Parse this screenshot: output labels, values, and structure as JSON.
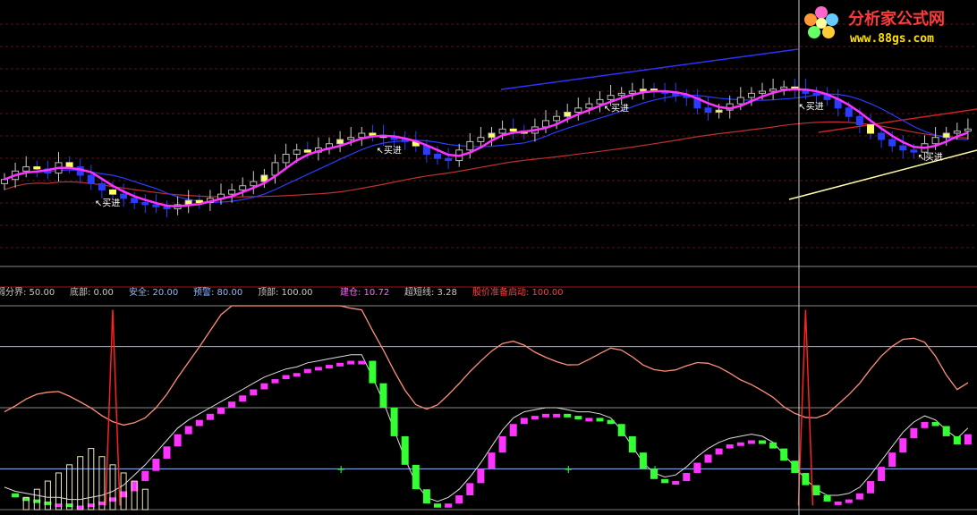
{
  "watermark": {
    "title": "分析家公式网",
    "url": "www.88gs.com"
  },
  "signals": [
    "买进",
    "买进",
    "买进",
    "买进",
    "买进"
  ],
  "legend": [
    {
      "label": "弱分界:",
      "value": "50.00",
      "color": "#c8c8c8"
    },
    {
      "label": "底部:",
      "value": "0.00",
      "color": "#c8c8c8"
    },
    {
      "label": "安全:",
      "value": "20.00",
      "color": "#8fb8ff"
    },
    {
      "label": "预警:",
      "value": "80.00",
      "color": "#8fb8ff"
    },
    {
      "label": "顶部:",
      "value": "100.00",
      "color": "#c8c8c8"
    },
    {
      "label": "建仓:",
      "value": "10.72",
      "color": "#ff66ff"
    },
    {
      "label": "超短线:",
      "value": "3.28",
      "color": "#c8c8c8"
    },
    {
      "label": "股价准备启动:",
      "value": "100.00",
      "color": "#ff4040"
    }
  ],
  "colors": {
    "magenta": "#ff33ff",
    "yellow": "#ffff66",
    "blue": "#2a3cff",
    "grey": "#8a8a8a",
    "salmon": "#ff8f7a",
    "green": "#33ff33",
    "red": "#ff2020",
    "darkred": "#c03030",
    "cream": "#ffffaa",
    "trend_blue": "#3030ff",
    "trend_red": "#cc2222",
    "white": "#ffffff"
  },
  "chart_data": [
    {
      "type": "candlestick",
      "overlays": [
        "short moving average (magenta)",
        "medium moving average (blue)",
        "long moving average (dark red)"
      ],
      "bars": 90,
      "closes": [
        38,
        42,
        44,
        43,
        41,
        46,
        44,
        40,
        36,
        33,
        31,
        29,
        27,
        26,
        25,
        24,
        26,
        28,
        27,
        29,
        31,
        33,
        35,
        37,
        40,
        46,
        50,
        52,
        51,
        53,
        55,
        57,
        58,
        60,
        59,
        58,
        57,
        56,
        54,
        50,
        48,
        47,
        52,
        56,
        58,
        60,
        62,
        61,
        60,
        63,
        66,
        68,
        70,
        72,
        74,
        76,
        78,
        79,
        80,
        81,
        80,
        79,
        78,
        77,
        72,
        70,
        71,
        74,
        77,
        79,
        80,
        81,
        82,
        81,
        79,
        78,
        76,
        72,
        68,
        64,
        60,
        57,
        54,
        52,
        51,
        55,
        58,
        60,
        61,
        62
      ]
    },
    {
      "type": "line",
      "indicator": true,
      "reference_levels": [
        0,
        20,
        50,
        80,
        100
      ],
      "legend_values": {
        "弱分界": 50.0,
        "底部": 0.0,
        "安全": 20.0,
        "预警": 80.0,
        "顶部": 100.0,
        "建仓": 10.72,
        "超短线": 3.28,
        "股价准备启动": 100.0
      },
      "oscillator": [
        8,
        6,
        5,
        4,
        3,
        3,
        2,
        2,
        3,
        4,
        6,
        9,
        14,
        19,
        25,
        31,
        37,
        41,
        44,
        47,
        50,
        53,
        56,
        59,
        62,
        64,
        66,
        67,
        69,
        70,
        71,
        72,
        73,
        73,
        62,
        50,
        36,
        22,
        10,
        3,
        1,
        3,
        7,
        13,
        20,
        28,
        36,
        42,
        45,
        46,
        47,
        47,
        46,
        45,
        45,
        44,
        42,
        36,
        28,
        20,
        15,
        13,
        14,
        18,
        23,
        27,
        30,
        32,
        33,
        34,
        33,
        30,
        24,
        18,
        12,
        7,
        4,
        4,
        5,
        8,
        14,
        21,
        28,
        35,
        40,
        43,
        41,
        36,
        32,
        37
      ]
    }
  ]
}
